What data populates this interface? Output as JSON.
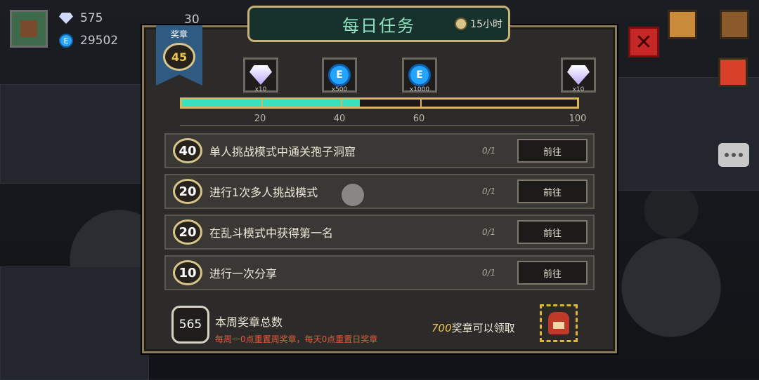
{
  "hud": {
    "gems": "575",
    "coins": "29502",
    "extra_value": "30"
  },
  "panel": {
    "title": "每日任务",
    "timer": "15小时",
    "badge_label": "奖章",
    "badge_value": "45"
  },
  "rewards": [
    {
      "icon": "diamond-icon",
      "qty": "x10"
    },
    {
      "icon": "e-coin-icon",
      "qty": "x500"
    },
    {
      "icon": "e-coin-icon",
      "qty": "x1000"
    },
    {
      "icon": "diamond-icon",
      "qty": "x10"
    }
  ],
  "progress": {
    "value": 45,
    "max": 100,
    "ticks": [
      "20",
      "40",
      "60",
      "100"
    ]
  },
  "tasks": [
    {
      "points": "40",
      "text": "单人挑战模式中通关孢子洞窟",
      "count": "0/1",
      "button": "前往"
    },
    {
      "points": "20",
      "text": "进行1次多人挑战模式",
      "count": "0/1",
      "button": "前往"
    },
    {
      "points": "20",
      "text": "在乱斗模式中获得第一名",
      "count": "0/1",
      "button": "前往"
    },
    {
      "points": "10",
      "text": "进行一次分享",
      "count": "0/1",
      "button": "前往"
    }
  ],
  "footer": {
    "weekly_total": "565",
    "title": "本周奖章总数",
    "note": "每周一0点重置周奖章，每天0点重置日奖章",
    "claim_amount": "700",
    "claim_text": "奖章可以领取"
  },
  "colors": {
    "accent_teal": "#38e0c0",
    "gold": "#d8b45a",
    "note_red": "#e25a3a"
  }
}
